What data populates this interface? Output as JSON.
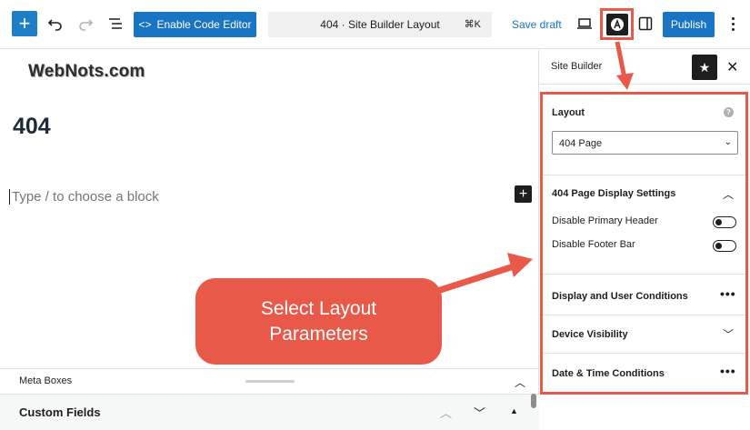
{
  "toolbar": {
    "code_editor_label": "Enable Code Editor",
    "document_title": "404 · Site Builder Layout",
    "shortcut": "⌘K",
    "save_draft_label": "Save draft",
    "publish_label": "Publish"
  },
  "canvas": {
    "logo_text": "WebNots.com",
    "page_heading": "404",
    "block_placeholder": "Type / to choose a block"
  },
  "meta": {
    "meta_boxes_label": "Meta Boxes",
    "custom_fields_label": "Custom Fields"
  },
  "sidebar": {
    "title": "Site Builder",
    "layout": {
      "title": "Layout",
      "selected": "404 Page"
    },
    "display_settings": {
      "title": "404 Page Display Settings",
      "toggles": [
        {
          "label": "Disable Primary Header",
          "on": false
        },
        {
          "label": "Disable Footer Bar",
          "on": false
        }
      ]
    },
    "sections": [
      {
        "title": "Display and User Conditions"
      },
      {
        "title": "Device Visibility"
      },
      {
        "title": "Date & Time Conditions"
      }
    ]
  },
  "annotation": {
    "line1": "Select Layout",
    "line2": "Parameters"
  },
  "colors": {
    "accent_blue": "#1a74c4",
    "annotation_red": "#e8594a",
    "dark": "#1e1e1e"
  }
}
